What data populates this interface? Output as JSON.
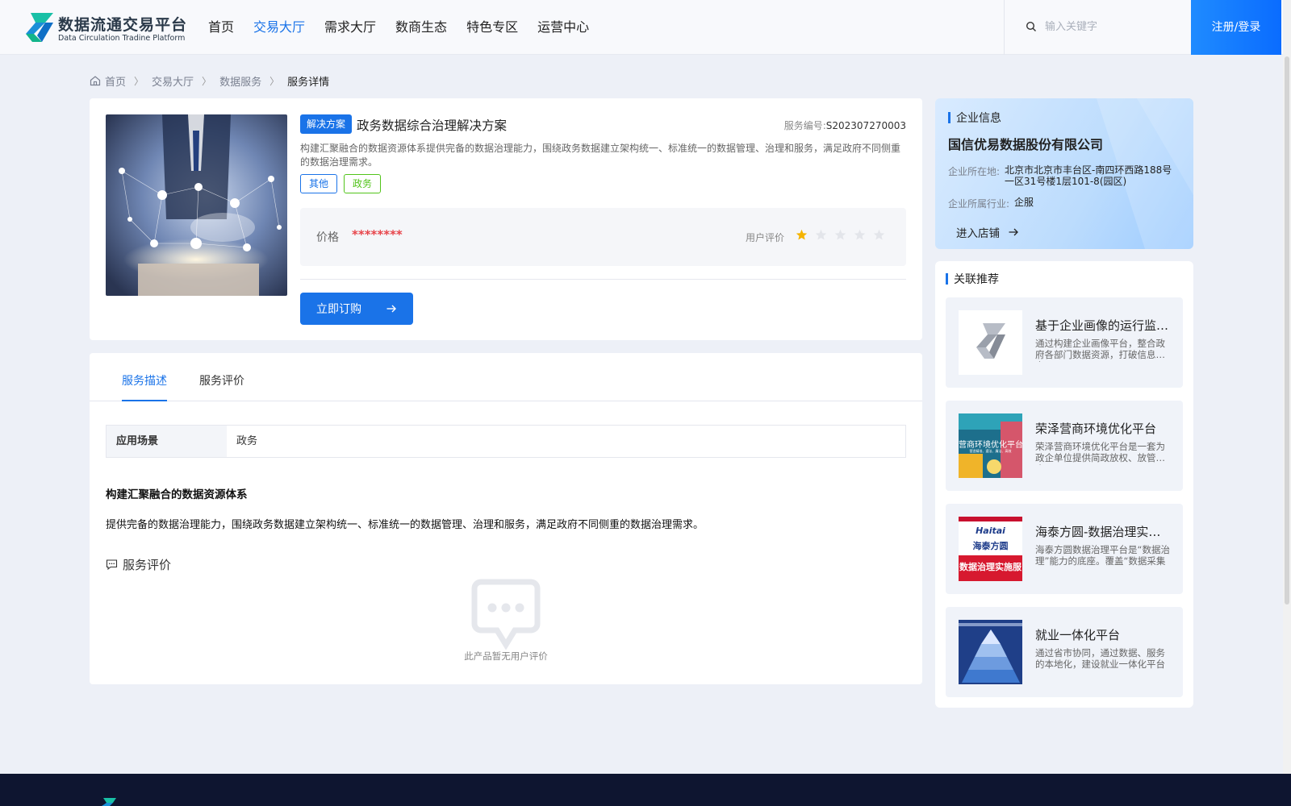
{
  "header": {
    "logo_title": "数据流通交易平台",
    "logo_subtitle": "Data Circulation Tradine Platform",
    "nav": [
      {
        "label": "首页",
        "active": false
      },
      {
        "label": "交易大厅",
        "active": true
      },
      {
        "label": "需求大厅",
        "active": false
      },
      {
        "label": "数商生态",
        "active": false
      },
      {
        "label": "特色专区",
        "active": false
      },
      {
        "label": "运营中心",
        "active": false
      }
    ],
    "search_placeholder": "输入关键字",
    "login_label": "注册/登录"
  },
  "breadcrumb": [
    "首页",
    "交易大厅",
    "数据服务",
    "服务详情"
  ],
  "product": {
    "badge": "解决方案",
    "title": "政务数据综合治理解决方案",
    "service_no_label": "服务编号:",
    "service_no": "S202307270003",
    "description": "构建汇聚融合的数据资源体系提供完备的数据治理能力，围绕政务数据建立架构统一、标准统一的数据管理、治理和服务，满足政府不同侧重的数据治理需求。",
    "tags": [
      "其他",
      "政务"
    ],
    "price_label": "价格",
    "price_value": "********",
    "rating_label": "用户评价",
    "rating": 1,
    "rating_max": 5,
    "buy_label": "立即订购"
  },
  "tabs": [
    {
      "label": "服务描述",
      "active": true
    },
    {
      "label": "服务评价",
      "active": false
    }
  ],
  "details": {
    "scene_key": "应用场景",
    "scene_value": "政务",
    "heading": "构建汇聚融合的数据资源体系",
    "body": "提供完备的数据治理能力，围绕政务数据建立架构统一、标准统一的数据管理、治理和服务，满足政府不同侧重的数据治理需求。",
    "review_heading": "服务评价",
    "empty_text": "此产品暂无用户评价"
  },
  "company": {
    "section_title": "企业信息",
    "name": "国信优易数据股份有限公司",
    "location_label": "企业所在地:",
    "location": "北京市北京市丰台区-南四环西路188号一区31号楼1层101-8(园区)",
    "industry_label": "企业所属行业:",
    "industry": "企服",
    "shop_label": "进入店铺"
  },
  "related": {
    "section_title": "关联推荐",
    "items": [
      {
        "title": "基于企业画像的运行监测平台",
        "desc": "通过构建企业画像平台，整合政府各部门数据资源，打破信息孤岛",
        "thumb": "logo"
      },
      {
        "title": "荣泽营商环境优化平台",
        "desc": "荣泽营商环境优化平台是一套为政企单位提供简政放权、放管结合",
        "thumb": "biz",
        "thumb_text": "营商环境优化平台",
        "thumb_sub": "营造精准、遵法、廉洁、高效"
      },
      {
        "title": "海泰方圆-数据治理实施服务",
        "desc": "海泰方圆数据治理平台是“数据治理”能力的底座。覆盖“数据采集",
        "thumb": "ht",
        "thumb_brand": "Haitai",
        "thumb_text": "海泰方圆",
        "thumb_sub": "数据治理实施服"
      },
      {
        "title": "就业一体化平台",
        "desc": "通过省市协同，通过数据、服务的本地化，建设就业一体化平台",
        "thumb": "pyr"
      }
    ]
  },
  "colors": {
    "primary": "#1a73e8",
    "price": "#e7454b",
    "star_on": "#f5b400",
    "star_off": "#e3e5ea",
    "footer": "#0e1530"
  }
}
